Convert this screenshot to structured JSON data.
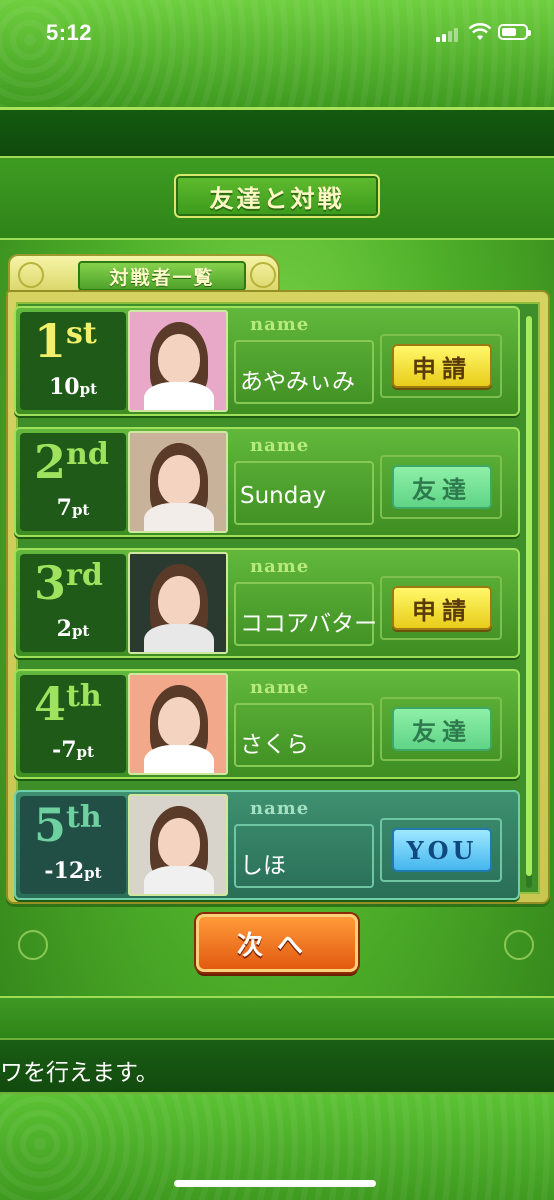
{
  "status_bar": {
    "time": "5:12"
  },
  "header": {
    "title": "友達と対戦"
  },
  "list": {
    "tab_label": "対戦者一覧",
    "field_label": "name",
    "rows": [
      {
        "rank_num": "1",
        "rank_suffix": "st",
        "points": "10",
        "points_unit": "pt",
        "name": "あやみぃみ",
        "action": "申請",
        "action_type": "apply",
        "photo_bg": "#e8a8c8",
        "photo_body": "#ffffff"
      },
      {
        "rank_num": "2",
        "rank_suffix": "nd",
        "points": "7",
        "points_unit": "pt",
        "name": "Sunday",
        "action": "友達",
        "action_type": "friend",
        "photo_bg": "#c8b29a",
        "photo_body": "#f2ede8"
      },
      {
        "rank_num": "3",
        "rank_suffix": "rd",
        "points": "2",
        "points_unit": "pt",
        "name": "ココアバター",
        "action": "申請",
        "action_type": "apply",
        "photo_bg": "#2a3a30",
        "photo_body": "#e8e8e8"
      },
      {
        "rank_num": "4",
        "rank_suffix": "th",
        "points": "-7",
        "points_unit": "pt",
        "name": "さくら",
        "action": "友達",
        "action_type": "friend",
        "photo_bg": "#f2a88a",
        "photo_body": "#ffffff"
      },
      {
        "rank_num": "5",
        "rank_suffix": "th",
        "points": "-12",
        "points_unit": "pt",
        "name": "しほ",
        "action": "YOU",
        "action_type": "you",
        "photo_bg": "#d8d4cc",
        "photo_body": "#f0f0f0"
      }
    ]
  },
  "next_button": {
    "label": "次へ"
  },
  "message": {
    "text": "ワを行えます。"
  },
  "colors": {
    "accent_yellow": "#f2f06a",
    "panel_green": "#3e8f2a",
    "next_orange": "#e25a10"
  }
}
